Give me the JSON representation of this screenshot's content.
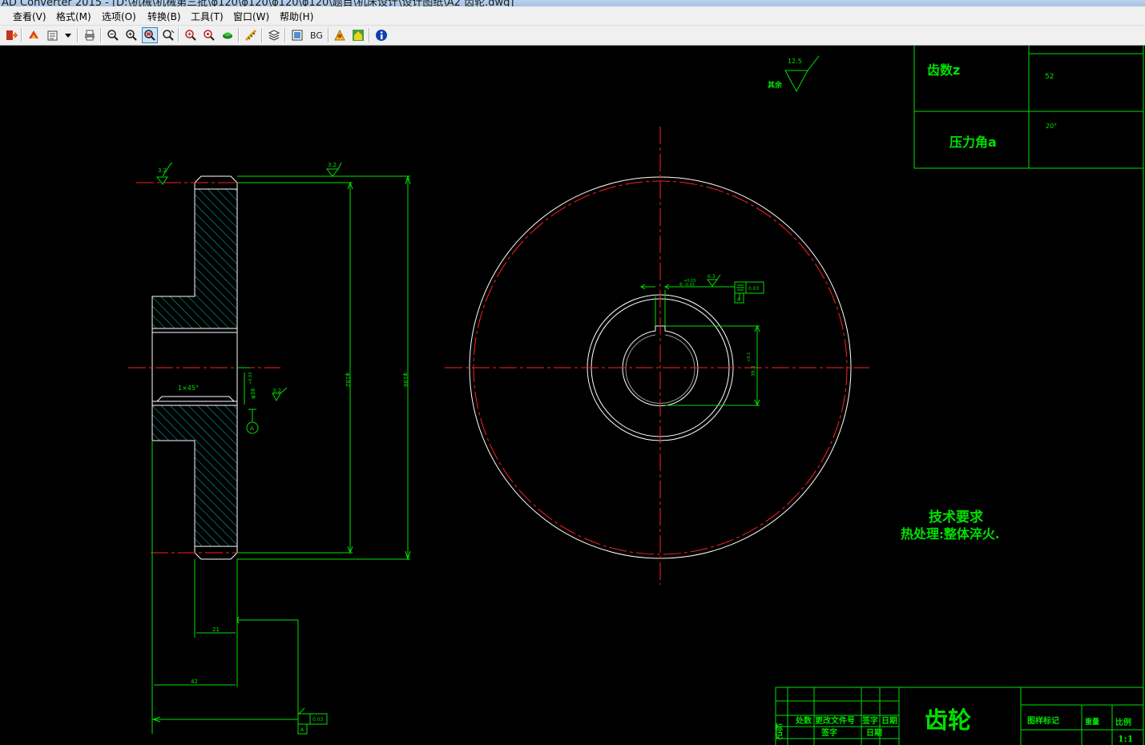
{
  "window": {
    "title": "AD Converter 2015 - [D:\\机械\\机械第三批\\φ120\\φ120\\φ120\\φ120\\题目\\机床设计\\设计图纸\\A2 齿轮.dwg]"
  },
  "menu": [
    "查看(V)",
    "格式(M)",
    "选项(O)",
    "转换(B)",
    "工具(T)",
    "窗口(W)",
    "帮助(H)"
  ],
  "toolbar": {
    "bg_label": "BG",
    "icons": [
      "exit-icon",
      "convert-icon",
      "batch-convert-icon",
      "dropdown-arrow-icon",
      "print-icon",
      "zoom-out-icon",
      "zoom-in-icon",
      "zoom-window-icon",
      "pan-icon",
      "zoom-realtime-icon",
      "zoom-extents-icon",
      "layer-icon",
      "measure-icon",
      "layers-icon",
      "view-icon",
      "background-icon",
      "person-icon",
      "home-icon",
      "info-icon"
    ]
  },
  "drawing": {
    "colors": {
      "background": "#000000",
      "outline": "#ffffff",
      "dimension": "#00ff00",
      "centerline": "#ff0000"
    },
    "roughness_overall": {
      "value": "12.5",
      "label": "其余"
    },
    "side_view": {
      "roughness_top_left": "3.2",
      "roughness_top_right": "3.2",
      "roughness_bore": "3.2",
      "chamfer": "1×45°",
      "bore_dia": "φ36",
      "bore_tol": "+0.03",
      "dia_inner": "φ182",
      "dia_outer": "φ188",
      "width_hub": "21",
      "width_total": "42",
      "datum": "A",
      "runout_tol": "0.03",
      "runout_datum": "A"
    },
    "front_view": {
      "keyway_width": "6",
      "keyway_tol_upper": "+0.03",
      "keyway_tol_lower": "-0.03",
      "keyway_roughness": "6.3",
      "symmetry_tol": "0.03",
      "symmetry_datum": "A",
      "keyway_depth": "39.3",
      "keyway_depth_tol": "+0.2"
    },
    "param_table": {
      "teeth_label": "齿数z",
      "teeth_value": "52",
      "pressure_label": "压力角a",
      "pressure_value": "20°"
    },
    "tech_req": {
      "title": "技术要求",
      "line1": "热处理:整体淬火."
    },
    "title_block": {
      "part_name": "齿轮",
      "c_mark": "标记",
      "c_count": "处数",
      "c_doc": "更改文件号",
      "c_sign": "签字",
      "c_date": "日期",
      "c_sign2": "签字",
      "c_date2": "日期",
      "c_stage": "图样标记",
      "c_weight": "重量",
      "c_scale": "比例",
      "scale_value": "1:1"
    }
  }
}
